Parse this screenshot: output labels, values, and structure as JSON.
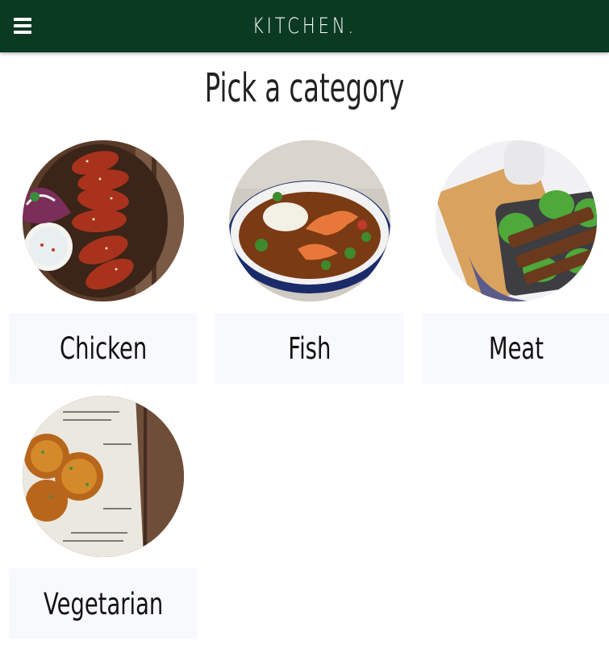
{
  "header": {
    "brand": "KITCHEN.",
    "menu_icon": "hamburger-menu-icon",
    "background": "#0b3a23"
  },
  "page": {
    "title": "Pick a category"
  },
  "categories": [
    {
      "label": "Chicken",
      "image": "chicken-wings-photo"
    },
    {
      "label": "Fish",
      "image": "shrimp-stew-photo"
    },
    {
      "label": "Meat",
      "image": "meat-skewers-photo"
    },
    {
      "label": "Vegetarian",
      "image": "vegetable-fritters-photo"
    }
  ]
}
